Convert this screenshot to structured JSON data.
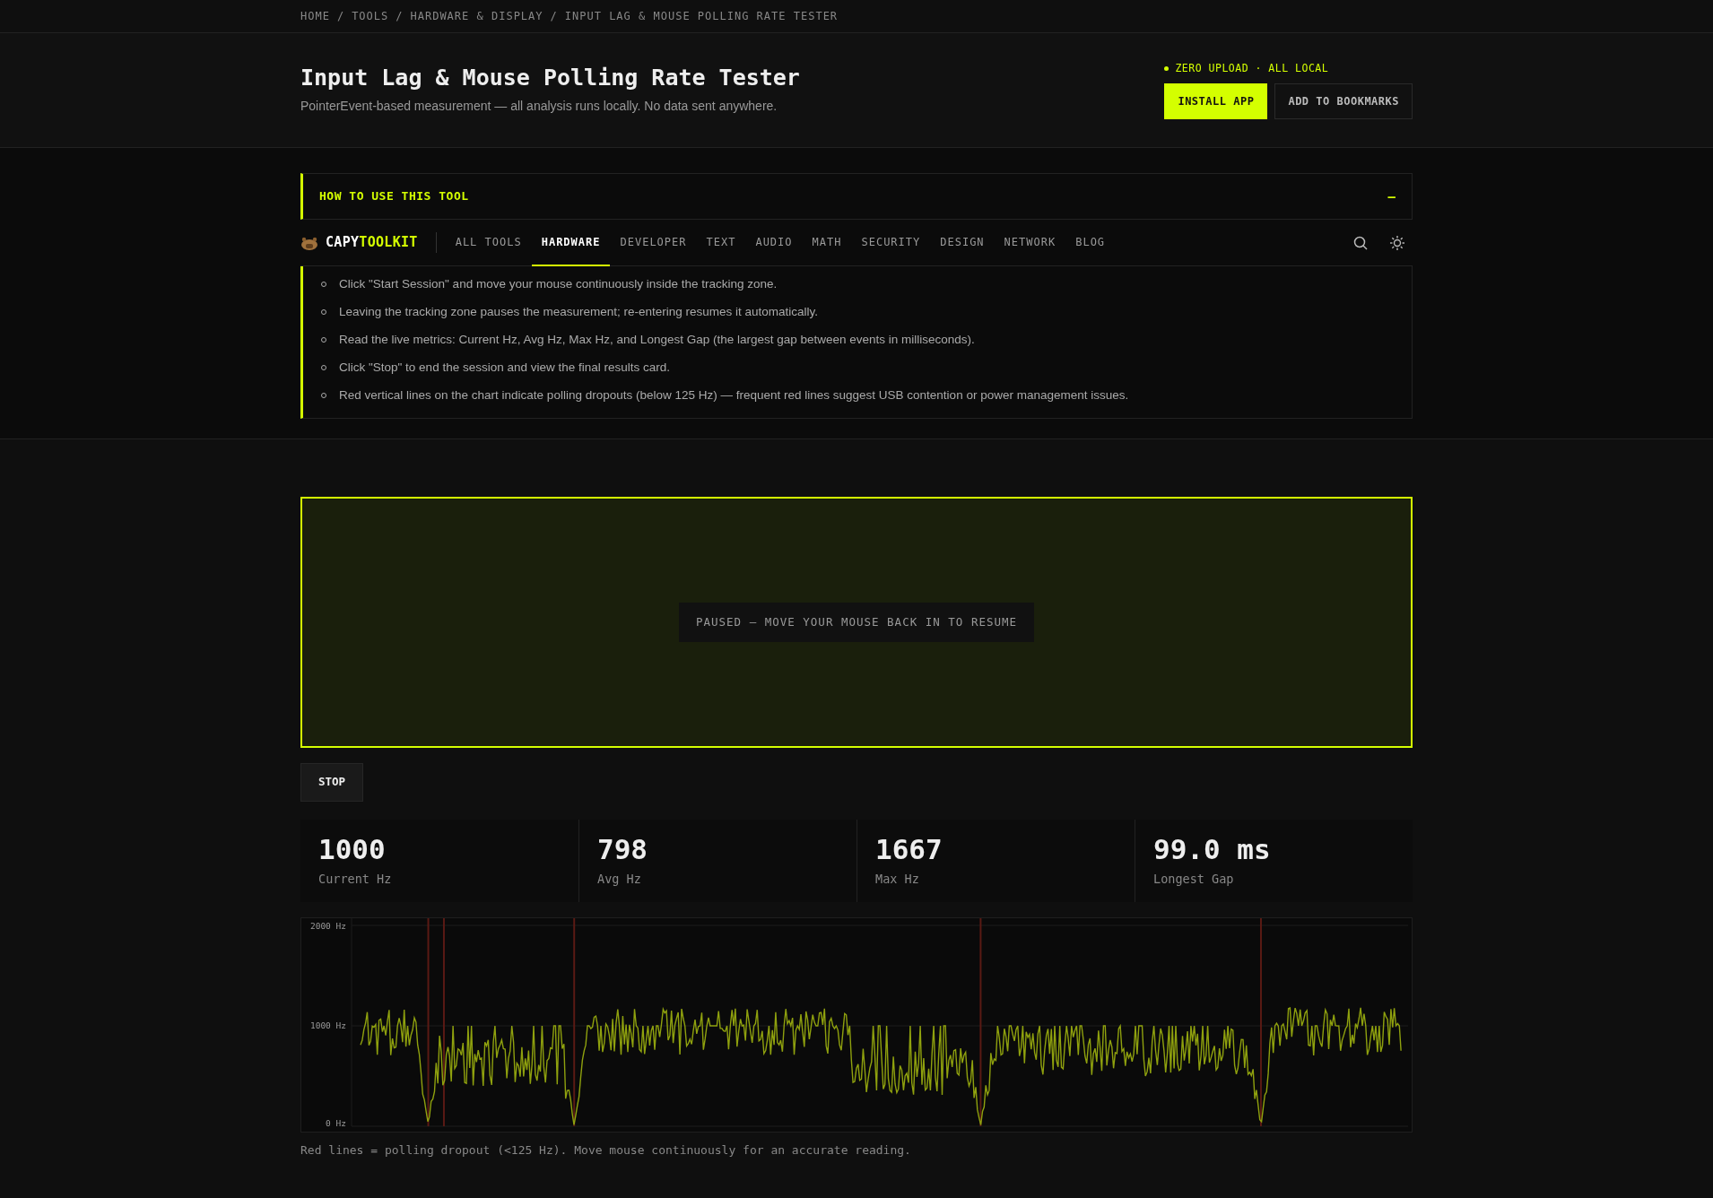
{
  "breadcrumb": {
    "separator": "/",
    "items": [
      "HOME",
      "TOOLS",
      "HARDWARE & DISPLAY",
      "INPUT LAG & MOUSE POLLING RATE TESTER"
    ]
  },
  "header": {
    "title": "Input Lag & Mouse Polling Rate Tester",
    "subtitle": "PointerEvent-based measurement — all analysis runs locally. No data sent anywhere.",
    "badge": "ZERO UPLOAD · ALL LOCAL",
    "buttons": [
      {
        "label": "INSTALL APP",
        "kind": "primary"
      },
      {
        "label": "ADD TO BOOKMARKS",
        "kind": "secondary"
      }
    ]
  },
  "howto": {
    "title": "HOW TO USE THIS TOOL",
    "toggle": "–",
    "expanded": true,
    "steps": [
      "Click \"Start Session\" and move your mouse continuously inside the tracking zone.",
      "Leaving the tracking zone pauses the measurement; re-entering resumes it automatically.",
      "Read the live metrics: Current Hz, Avg Hz, Max Hz, and Longest Gap (the largest gap between events in milliseconds).",
      "Click \"Stop\" to end the session and view the final results card.",
      "Red vertical lines on the chart indicate polling dropouts (below 125 Hz) — frequent red lines suggest USB contention or power management issues."
    ]
  },
  "nav": {
    "logo_prefix": "CAPY",
    "logo_accent": "TOOLKIT",
    "items": [
      {
        "label": "ALL TOOLS",
        "selected": false
      },
      {
        "label": "HARDWARE",
        "selected": true
      },
      {
        "label": "DEVELOPER",
        "selected": false
      },
      {
        "label": "TEXT",
        "selected": false
      },
      {
        "label": "AUDIO",
        "selected": false
      },
      {
        "label": "MATH",
        "selected": false
      },
      {
        "label": "SECURITY",
        "selected": false
      },
      {
        "label": "DESIGN",
        "selected": false
      },
      {
        "label": "NETWORK",
        "selected": false
      },
      {
        "label": "BLOG",
        "selected": false
      }
    ]
  },
  "tracking": {
    "message": "PAUSED — MOVE YOUR MOUSE BACK IN TO RESUME"
  },
  "stop_button": "STOP",
  "stats": [
    {
      "value": "1000",
      "label": "Current Hz"
    },
    {
      "value": "798",
      "label": "Avg Hz"
    },
    {
      "value": "1667",
      "label": "Max Hz"
    },
    {
      "value": "99.0 ms",
      "label": "Longest Gap"
    }
  ],
  "chart": {
    "y_labels": [
      "2000 Hz",
      "1000 Hz",
      "0 Hz"
    ]
  },
  "caption": "Red lines = polling dropout (<125 Hz). Move mouse continuously for an accurate reading."
}
